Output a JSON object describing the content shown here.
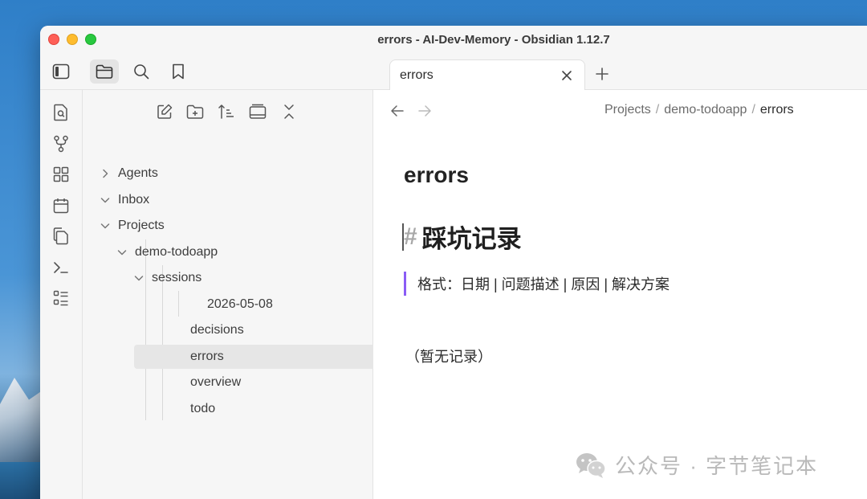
{
  "window": {
    "title": "errors - AI-Dev-Memory - Obsidian 1.12.7"
  },
  "tab": {
    "label": "errors"
  },
  "sidebar": {
    "tree": [
      {
        "label": "Agents",
        "expanded": false
      },
      {
        "label": "Inbox",
        "expanded": true
      },
      {
        "label": "Projects",
        "expanded": true
      },
      {
        "label": "demo-todoapp",
        "expanded": true
      },
      {
        "label": "sessions",
        "expanded": true
      },
      {
        "label": "2026-05-08"
      },
      {
        "label": "decisions"
      },
      {
        "label": "errors",
        "selected": true
      },
      {
        "label": "overview"
      },
      {
        "label": "todo"
      }
    ]
  },
  "breadcrumb": {
    "items": [
      "Projects",
      "demo-todoapp",
      "errors"
    ],
    "separator": "/"
  },
  "note": {
    "title": "errors",
    "heading_marker": "#",
    "heading": "踩坑记录",
    "quote": "格式：日期 | 问题描述 | 原因 | 解决方案",
    "paragraph": "（暂无记录）"
  },
  "watermark": {
    "text": "公众号 · 字节笔记本"
  },
  "colors": {
    "accent": "#8a5cf5",
    "close": "#fe5f57",
    "minimize": "#febc2e",
    "maximize": "#28c840"
  }
}
